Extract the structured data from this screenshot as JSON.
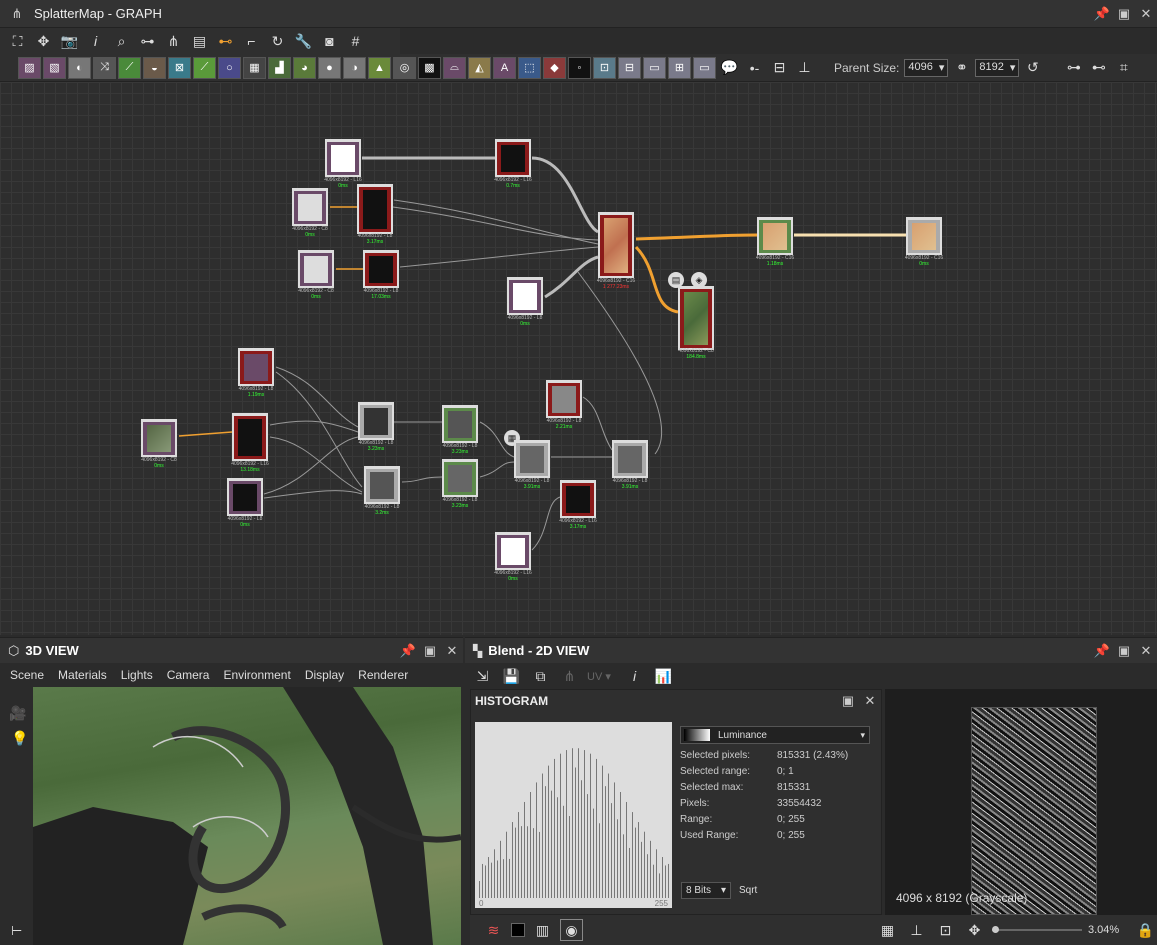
{
  "graph": {
    "title": "SplatterMap - GRAPH",
    "parent_size_label": "Parent Size:",
    "parent_size_w": "4096",
    "parent_size_h": "8192"
  },
  "nodes": {
    "n4096_l16": "4096x8192 - L16",
    "n4096_l8": "4096x8192 - L8",
    "n4096_c8": "4096x8192 - C8",
    "n4096_c16": "4096x8192 - C16",
    "t0": "0ms",
    "t1": "0.7ms",
    "t2": "3.17ms",
    "t3": "17.03ms",
    "t4": "1.18ms",
    "t5": "184.8ms",
    "t6": "1.19ms",
    "t7": "13.18ms",
    "t8": "3.23ms",
    "t9": "2.21ms",
    "t10": "3.91ms",
    "t11": "3.2ms",
    "t12": "3.17ms",
    "t13": "2.21ms",
    "t14": "1 277.23ms"
  },
  "view3d": {
    "title": "3D VIEW",
    "menu": [
      "Scene",
      "Materials",
      "Lights",
      "Camera",
      "Environment",
      "Display",
      "Renderer"
    ]
  },
  "view2d": {
    "title": "Blend - 2D VIEW",
    "uv": "UV",
    "resolution": "4096 x 8192 (Grayscale)",
    "zoom": "3.04%"
  },
  "histogram": {
    "title": "HISTOGRAM",
    "mode": "Luminance",
    "axis_min": "0",
    "axis_max": "255",
    "bits": "8 Bits",
    "sqrt": "Sqrt",
    "rows": [
      {
        "k": "Selected pixels:",
        "v": "815331 (2.43%)"
      },
      {
        "k": "Selected range:",
        "v": "0; 1"
      },
      {
        "k": "Selected max:",
        "v": "815331"
      },
      {
        "k": "Pixels:",
        "v": "33554432"
      },
      {
        "k": "Range:",
        "v": "0; 255"
      },
      {
        "k": "Used Range:",
        "v": "0; 255"
      }
    ]
  },
  "colors": {
    "accent": "#f0a030",
    "node_mauve": "#6a4a68",
    "node_red": "#8b1a1a",
    "node_green": "#5c8a4a",
    "node_gray": "#aaaaaa"
  }
}
